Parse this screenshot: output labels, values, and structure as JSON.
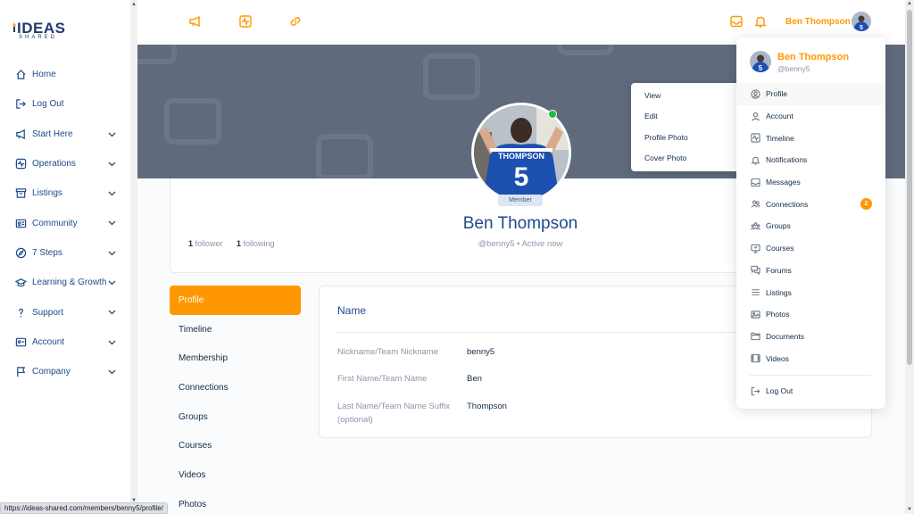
{
  "brand": {
    "logo_top": "IDEAS",
    "logo_bottom": "SHARED"
  },
  "sidebar": {
    "items": [
      {
        "label": "Home",
        "icon": "home-icon",
        "chevron": false
      },
      {
        "label": "Log Out",
        "icon": "logout-icon",
        "chevron": false
      },
      {
        "label": "Start Here",
        "icon": "megaphone-icon",
        "chevron": true
      },
      {
        "label": "Operations",
        "icon": "pulse-icon",
        "chevron": true
      },
      {
        "label": "Listings",
        "icon": "archive-icon",
        "chevron": true
      },
      {
        "label": "Community",
        "icon": "id-card-icon",
        "chevron": true
      },
      {
        "label": "7 Steps",
        "icon": "compass-icon",
        "chevron": true
      },
      {
        "label": "Learning & Growth",
        "icon": "graduation-icon",
        "chevron": true
      },
      {
        "label": "Support",
        "icon": "question-icon",
        "chevron": true
      },
      {
        "label": "Account",
        "icon": "user-card-icon",
        "chevron": true
      },
      {
        "label": "Company",
        "icon": "flag-icon",
        "chevron": true
      }
    ]
  },
  "header": {
    "icons": [
      "megaphone-icon",
      "pulse-icon",
      "link-icon",
      "inbox-icon",
      "bell-icon"
    ],
    "user_name": "Ben Thompson"
  },
  "profile": {
    "name": "Ben Thompson",
    "handle_line": "@benny5 • Active now",
    "member_badge": "Member",
    "followers_count": "1",
    "followers_label": "follower",
    "following_count": "1",
    "following_label": "following",
    "jersey_name": "THOMPSON",
    "jersey_number": "5"
  },
  "tabs": [
    "Profile",
    "Timeline",
    "Membership",
    "Connections",
    "Groups",
    "Courses",
    "Videos",
    "Photos"
  ],
  "active_tab": "Profile",
  "name_panel": {
    "title": "Name",
    "fields": [
      {
        "label": "Nickname/Team Nickname",
        "value": "benny5"
      },
      {
        "label": "First Name/Team Name",
        "value": "Ben"
      },
      {
        "label": "Last Name/Team Name Suffix (optional)",
        "value": "Thompson"
      }
    ]
  },
  "context_menu": [
    "View",
    "Edit",
    "Profile Photo",
    "Cover Photo"
  ],
  "dropdown": {
    "name": "Ben Thompson",
    "handle": "@benny5",
    "items": [
      {
        "label": "Profile",
        "icon": "user-circle-icon",
        "active": true
      },
      {
        "label": "Account",
        "icon": "user-icon"
      },
      {
        "label": "Timeline",
        "icon": "activity-icon"
      },
      {
        "label": "Notifications",
        "icon": "bell-icon"
      },
      {
        "label": "Messages",
        "icon": "inbox-icon"
      },
      {
        "label": "Connections",
        "icon": "users-icon",
        "badge": "2"
      },
      {
        "label": "Groups",
        "icon": "groups-icon"
      },
      {
        "label": "Courses",
        "icon": "monitor-icon"
      },
      {
        "label": "Forums",
        "icon": "chat-icon"
      },
      {
        "label": "Listings",
        "icon": "list-icon"
      },
      {
        "label": "Photos",
        "icon": "image-icon"
      },
      {
        "label": "Documents",
        "icon": "folder-icon"
      },
      {
        "label": "Videos",
        "icon": "film-icon"
      }
    ],
    "logout": "Log Out"
  },
  "status_url": "https://ideas-shared.com/members/benny5/profile/",
  "colors": {
    "accent": "#ff9800",
    "nav_text": "#1e4a8a",
    "cover": "#5f6b7c",
    "online": "#26b94a"
  }
}
